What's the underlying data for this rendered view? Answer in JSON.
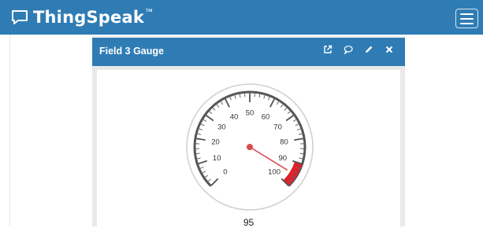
{
  "app": {
    "brand": "ThingSpeak",
    "trademark": "™"
  },
  "header": {
    "menu_icon": "hamburger-menu-icon"
  },
  "widget": {
    "title": "Field 3 Gauge",
    "tools": [
      "external-link-icon",
      "comment-icon",
      "pencil-icon",
      "close-icon"
    ],
    "gauge": {
      "min": 0,
      "max": 100,
      "value": 95,
      "value_label": "95",
      "ticks": [
        "0",
        "10",
        "20",
        "30",
        "40",
        "50",
        "60",
        "70",
        "80",
        "90",
        "100"
      ],
      "red_band": [
        90,
        100
      ],
      "colors": {
        "band": "#e0202a",
        "needle": "#d84a50",
        "ring": "#555555"
      }
    }
  },
  "colors": {
    "brand_blue": "#2f7cb5"
  }
}
